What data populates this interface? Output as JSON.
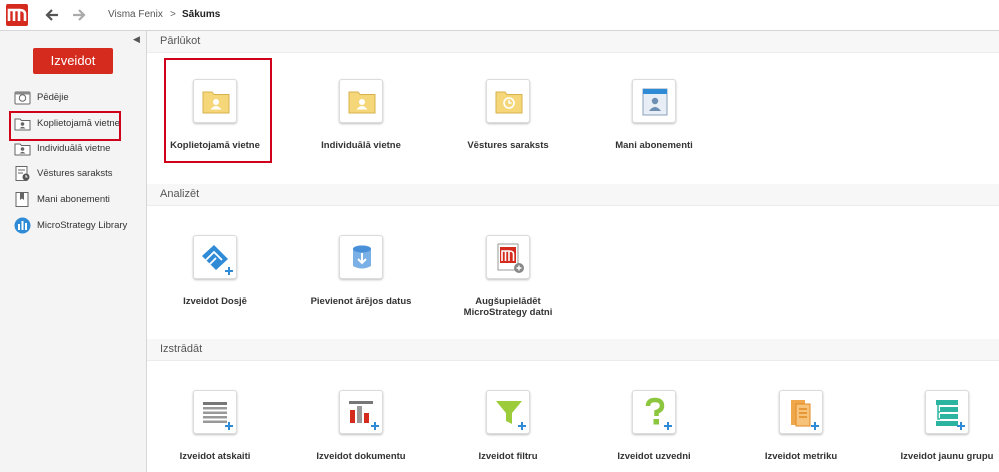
{
  "header": {
    "breadcrumb_root": "Visma Fenix",
    "breadcrumb_sep": ">",
    "breadcrumb_current": "Sākums",
    "logo_icon": "microstrategy-logo",
    "back_icon": "arrow-left-icon",
    "forward_icon": "arrow-right-icon"
  },
  "sidebar": {
    "collapse_glyph": "◀",
    "create_label": "Izveidot",
    "items": [
      {
        "label": "Pēdējie",
        "icon": "recent-icon"
      },
      {
        "label": "Koplietojamā vietne",
        "icon": "shared-folder-icon"
      },
      {
        "label": "Individuālā vietne",
        "icon": "personal-folder-icon"
      },
      {
        "label": "Vēstures saraksts",
        "icon": "history-list-icon"
      },
      {
        "label": "Mani abonementi",
        "icon": "subscriptions-icon"
      },
      {
        "label": "MicroStrategy Library",
        "icon": "library-icon"
      }
    ]
  },
  "main": {
    "sections": [
      {
        "title": "Pārlūkot",
        "tiles": [
          {
            "label": "Koplietojamā vietne",
            "icon": "shared-folder-icon"
          },
          {
            "label": "Individuālā vietne",
            "icon": "personal-folder-icon"
          },
          {
            "label": "Vēstures saraksts",
            "icon": "history-folder-icon"
          },
          {
            "label": "Mani abonementi",
            "icon": "subscriptions-icon"
          }
        ]
      },
      {
        "title": "Analizēt",
        "tiles": [
          {
            "label": "Izveidot Dosjē",
            "icon": "dossier-add-icon"
          },
          {
            "label": "Pievienot ārējos datus",
            "icon": "database-import-icon"
          },
          {
            "label_line1": "Augšupielādēt",
            "label_line2": "MicroStrategy datni",
            "icon": "upload-mstr-file-icon"
          }
        ]
      },
      {
        "title": "Izstrādāt",
        "tiles": [
          {
            "label": "Izveidot atskaiti",
            "icon": "report-add-icon"
          },
          {
            "label": "Izveidot dokumentu",
            "icon": "document-add-icon"
          },
          {
            "label": "Izveidot filtru",
            "icon": "filter-add-icon"
          },
          {
            "label": "Izveidot uzvedni",
            "icon": "prompt-add-icon"
          },
          {
            "label": "Izveidot metriku",
            "icon": "metric-add-icon"
          },
          {
            "label": "Izveidot jaunu grupu",
            "icon": "group-add-icon"
          }
        ]
      }
    ]
  },
  "colors": {
    "brand_red": "#d52b1e",
    "highlight_red": "#d0021b",
    "folder_yellow": "#f5d77a",
    "accent_blue": "#2f8bd6",
    "accent_green": "#2bb5a0"
  }
}
